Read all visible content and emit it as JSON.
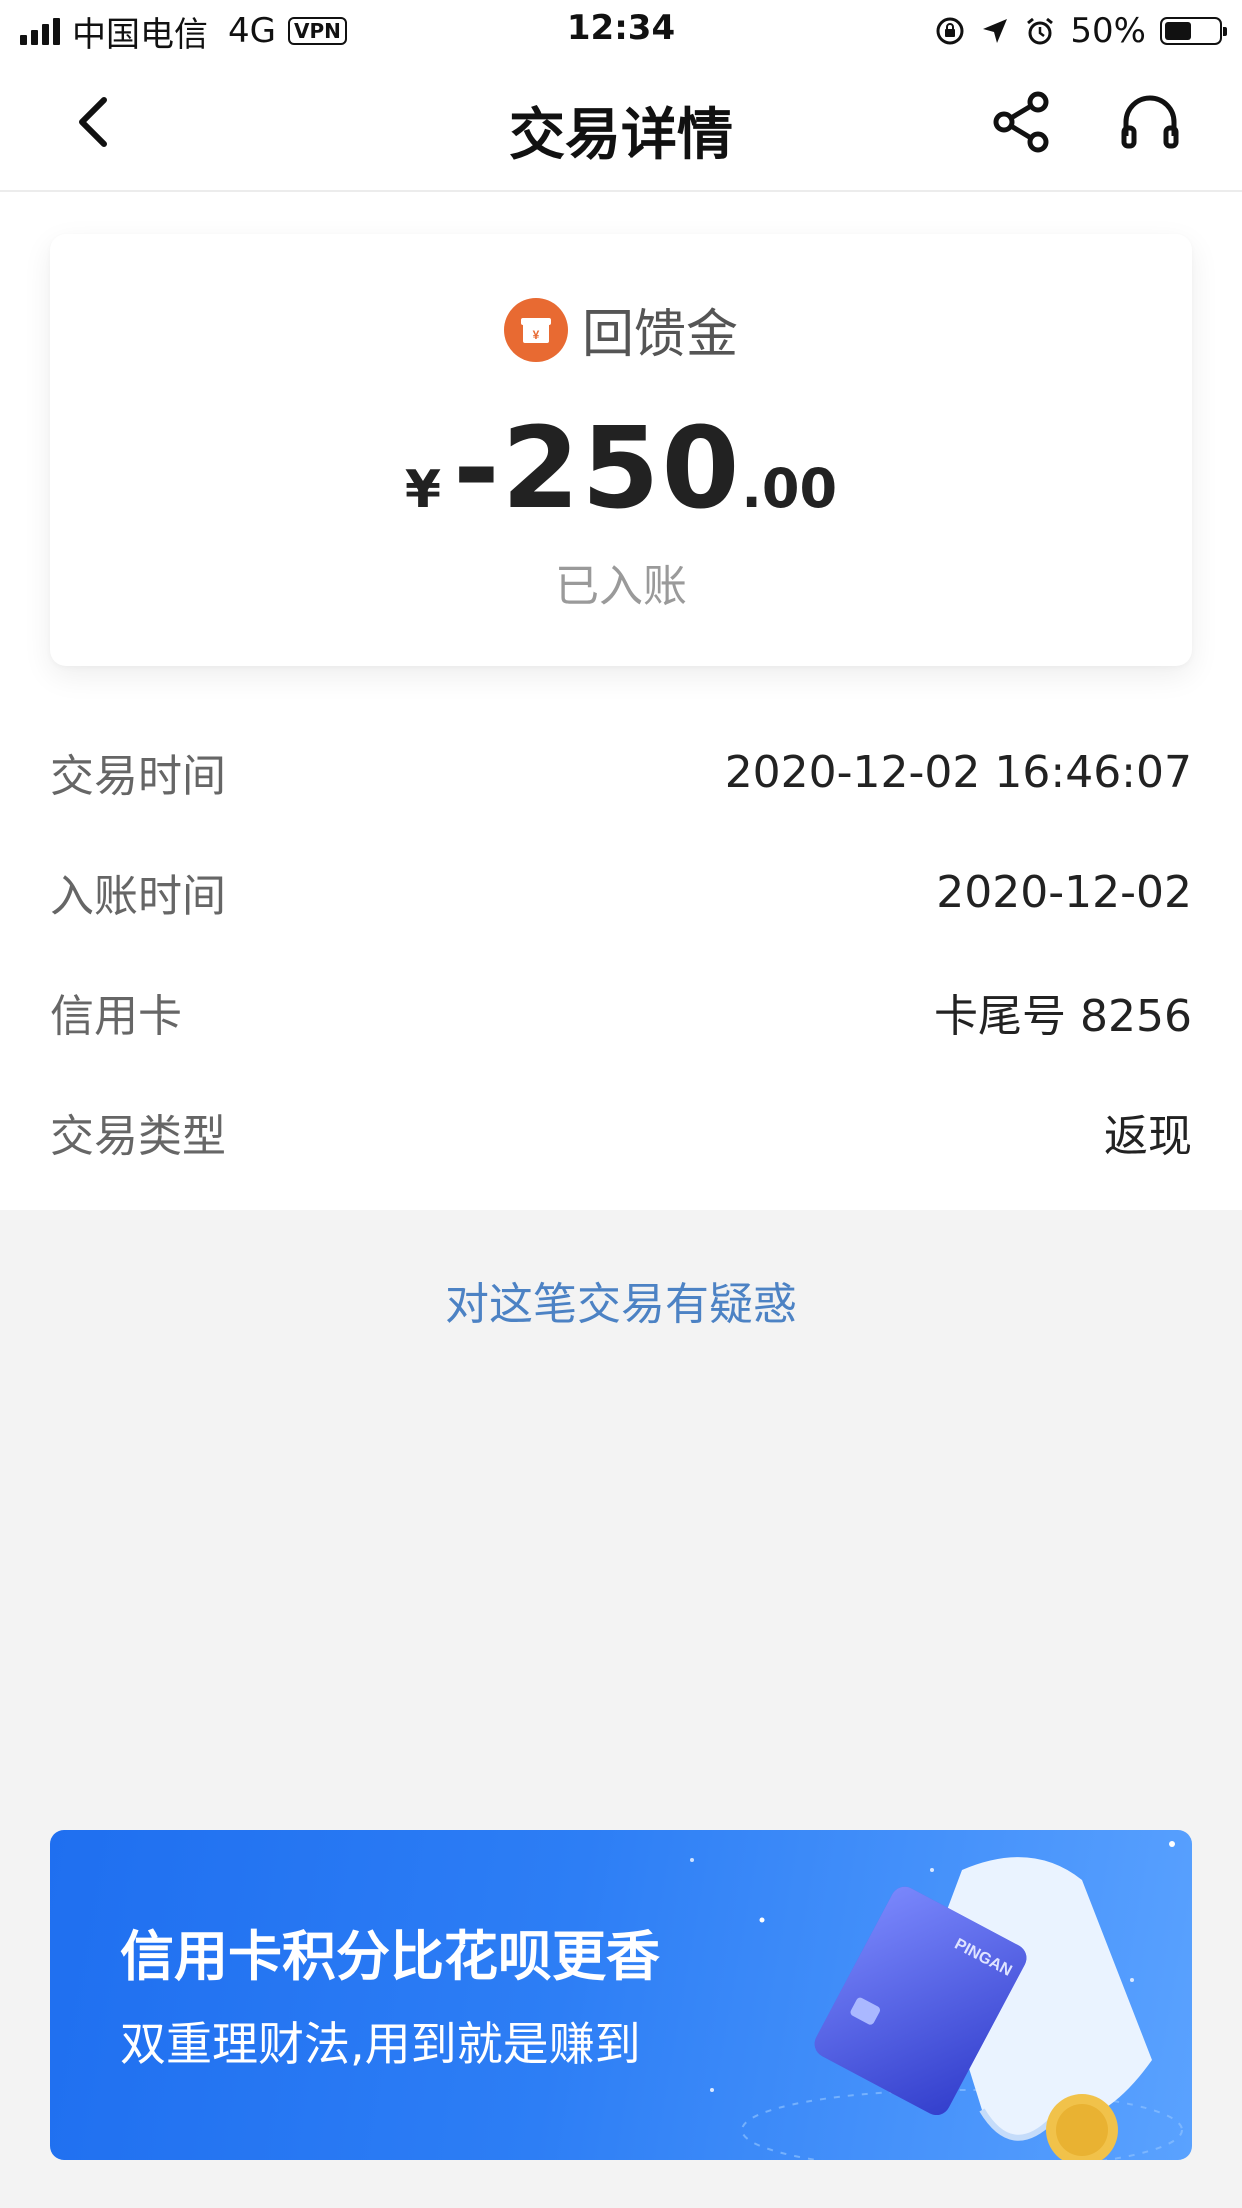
{
  "status_bar": {
    "carrier": "中国电信",
    "network": "4G",
    "vpn": "VPN",
    "time": "12:34",
    "battery_percent": "50%",
    "battery_level": 0.5,
    "icons": [
      "signal-icon",
      "orientation-lock-icon",
      "location-icon",
      "alarm-icon",
      "battery-icon"
    ]
  },
  "navbar": {
    "title": "交易详情",
    "icons": [
      "back-icon",
      "share-icon",
      "headset-icon"
    ]
  },
  "summary": {
    "type_label": "回馈金",
    "type_icon": "gift-icon",
    "icon_color": "#e86a32",
    "currency": "¥",
    "amount_integer": "-250",
    "amount_decimal": ".00",
    "status": "已入账"
  },
  "details": [
    {
      "label": "交易时间",
      "value": "2020-12-02 16:46:07"
    },
    {
      "label": "入账时间",
      "value": "2020-12-02"
    },
    {
      "label": "信用卡",
      "value": "卡尾号 8256"
    },
    {
      "label": "交易类型",
      "value": "返现"
    }
  ],
  "query_link": "对这笔交易有疑惑",
  "banner": {
    "title": "信用卡积分比花呗更香",
    "subtitle": "双重理财法,用到就是赚到",
    "card_text": "PINGAN"
  },
  "colors": {
    "link": "#4c82c4",
    "background": "#f3f3f3",
    "banner_blue": "#2d7ef5"
  }
}
